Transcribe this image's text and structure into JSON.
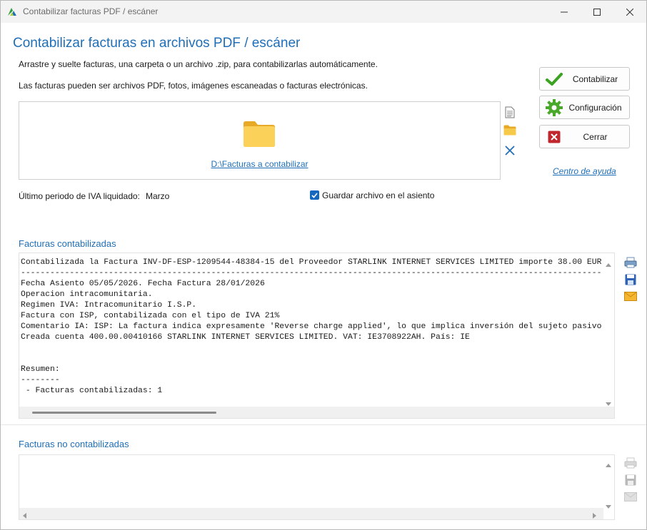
{
  "window": {
    "title": "Contabilizar facturas PDF / escáner"
  },
  "heading": "Contabilizar facturas en archivos PDF / escáner",
  "instructions": {
    "line1": "Arrastre y suelte facturas, una carpeta o un archivo .zip, para contabilizarlas automáticamente.",
    "line2": "Las facturas pueden ser archivos PDF, fotos, imágenes escaneadas o facturas electrónicas."
  },
  "dropzone": {
    "folder_path": "D:\\Facturas a contabilizar"
  },
  "buttons": {
    "contabilizar": "Contabilizar",
    "configuracion": "Configuración",
    "cerrar": "Cerrar"
  },
  "help_link": "Centro de ayuda",
  "iva": {
    "label": "Último periodo de IVA liquidado:",
    "value": "Marzo"
  },
  "save_file_checkbox": {
    "label": "Guardar archivo en el asiento",
    "checked": true
  },
  "sections": {
    "posted": "Facturas contabilizadas",
    "not_posted": "Facturas no contabilizadas"
  },
  "log_lines": [
    "Contabilizada la Factura INV-DF-ESP-1209544-48384-15 del Proveedor STARLINK INTERNET SERVICES LIMITED importe 38.00 EUR",
    "--------------------------------------------------------------------------------------------------------------------------",
    "Fecha Asiento 05/05/2026. Fecha Factura 28/01/2026",
    "Operacion intracomunitaria.",
    "Regimen IVA: Intracomunitario I.S.P.",
    "Factura con ISP, contabilizada con el tipo de IVA 21%",
    "Comentario IA: ISP: La factura indica expresamente 'Reverse charge applied', lo que implica inversión del sujeto pasivo.",
    "Creada cuenta 400.00.00410166 STARLINK INTERNET SERVICES LIMITED. VAT: IE3708922AH. País: IE",
    "",
    "",
    "Resumen:",
    "--------",
    " - Facturas contabilizadas: 1"
  ],
  "colors": {
    "accent": "#1f6fb8",
    "check_green": "#3aa31f",
    "close_red": "#c0272d",
    "folder_yellow": "#f5c542"
  },
  "icons": {
    "side": [
      "document-icon",
      "folder-icon",
      "clear-icon"
    ],
    "right_panel": [
      "print-icon",
      "save-icon",
      "email-icon"
    ]
  }
}
